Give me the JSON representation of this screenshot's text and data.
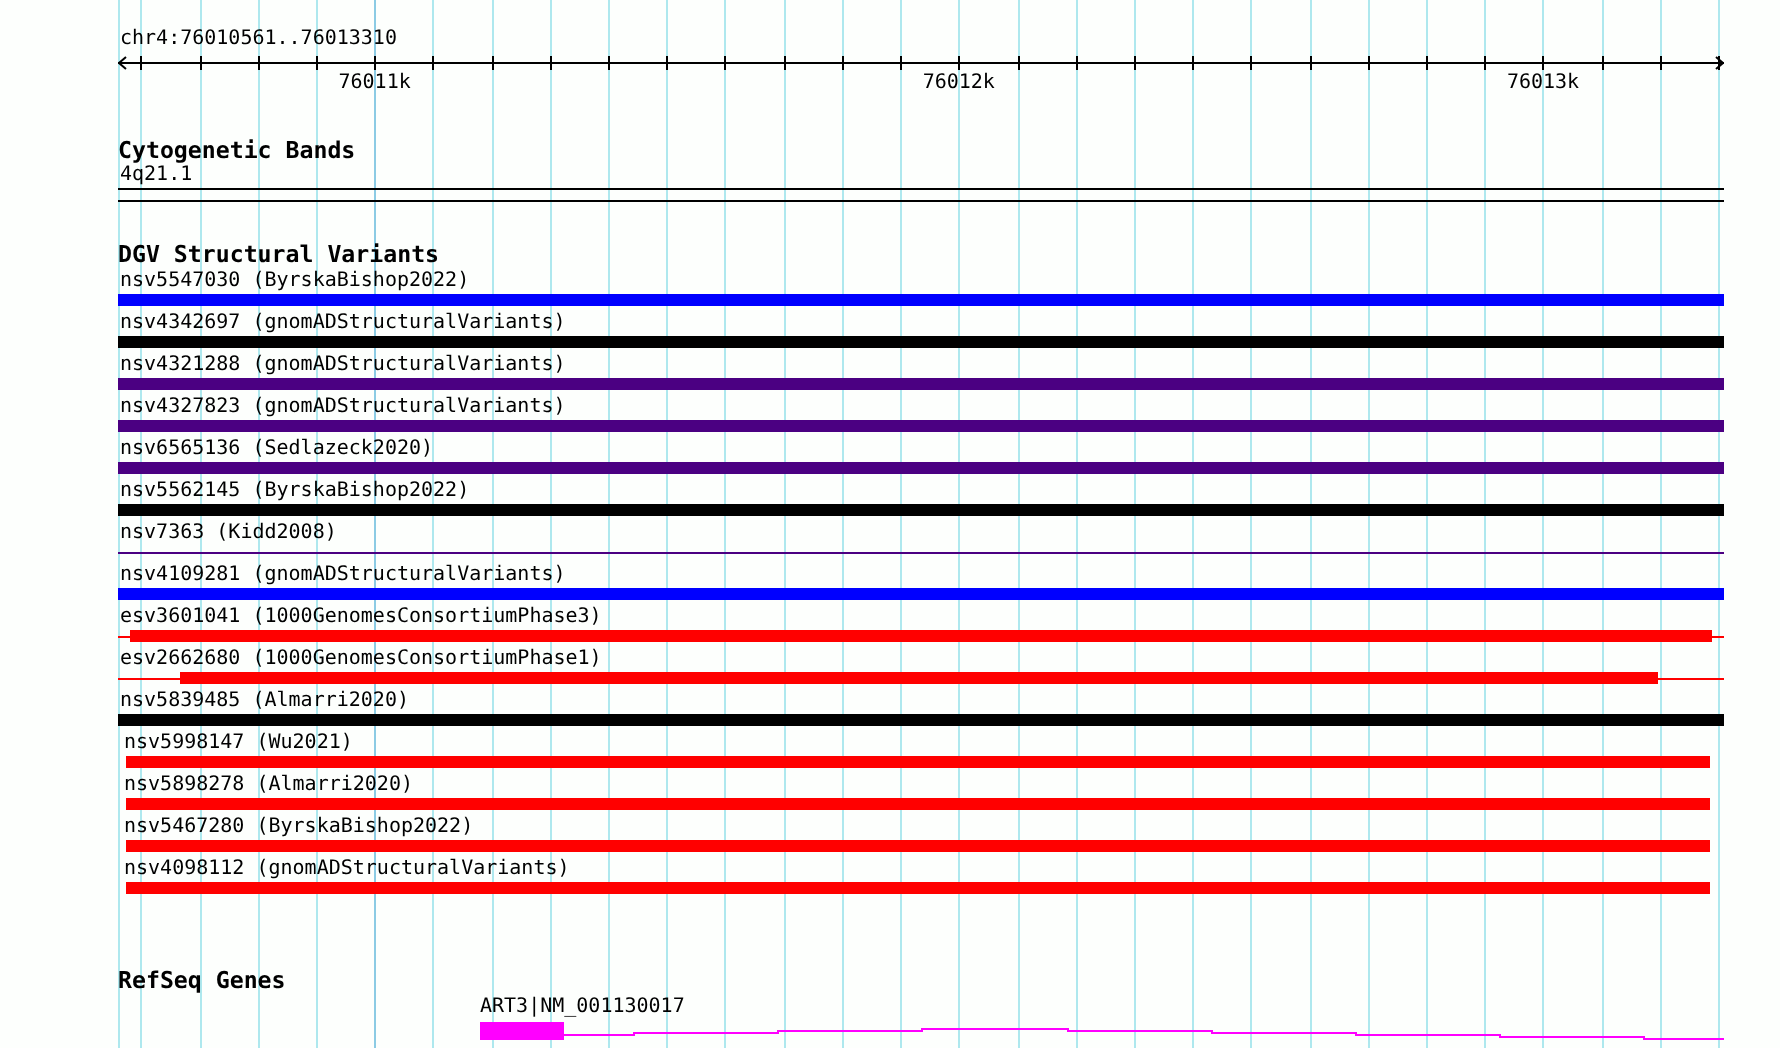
{
  "ruler": {
    "location": "chr4:76010561..76013310",
    "tick_labels": [
      "76011k",
      "76012k",
      "76013k"
    ]
  },
  "tracks": [
    {
      "kind": "cytoband",
      "title": "Cytogenetic Bands",
      "features": [
        {
          "label": "4q21.1"
        }
      ]
    },
    {
      "kind": "variants",
      "title": "DGV Structural Variants",
      "features": [
        {
          "label": "nsv5547030 (ByrskaBishop2022)",
          "color": "#0000ff",
          "kind": "full"
        },
        {
          "label": "nsv4342697 (gnomADStructuralVariants)",
          "color": "#000000",
          "kind": "full"
        },
        {
          "label": "nsv4321288 (gnomADStructuralVariants)",
          "color": "#4b0082",
          "kind": "full"
        },
        {
          "label": "nsv4327823 (gnomADStructuralVariants)",
          "color": "#4b0082",
          "kind": "full"
        },
        {
          "label": "nsv6565136 (Sedlazeck2020)",
          "color": "#4b0082",
          "kind": "full"
        },
        {
          "label": "nsv5562145 (ByrskaBishop2022)",
          "color": "#000000",
          "kind": "full"
        },
        {
          "label": "nsv7363 (Kidd2008)",
          "color": "#4b0082",
          "kind": "line"
        },
        {
          "label": "nsv4109281 (gnomADStructuralVariants)",
          "color": "#0000ff",
          "kind": "full"
        },
        {
          "label": "esv3601041 (1000GenomesConsortiumPhase3)",
          "color": "#ff0000",
          "kind": "flanked"
        },
        {
          "label": "esv2662680 (1000GenomesConsortiumPhase1)",
          "color": "#ff0000",
          "kind": "flanked-short"
        },
        {
          "label": "nsv5839485 (Almarri2020)",
          "color": "#000000",
          "kind": "full"
        },
        {
          "label": "nsv5998147 (Wu2021)",
          "color": "#ff0000",
          "kind": "inset"
        },
        {
          "label": "nsv5898278 (Almarri2020)",
          "color": "#ff0000",
          "kind": "inset"
        },
        {
          "label": "nsv5467280 (ByrskaBishop2022)",
          "color": "#ff0000",
          "kind": "inset"
        },
        {
          "label": "nsv4098112 (gnomADStructuralVariants)",
          "color": "#ff0000",
          "kind": "inset"
        }
      ]
    },
    {
      "kind": "genes",
      "title": "RefSeq Genes",
      "features": [
        {
          "label": "ART3|NM_001130017"
        }
      ]
    }
  ]
}
